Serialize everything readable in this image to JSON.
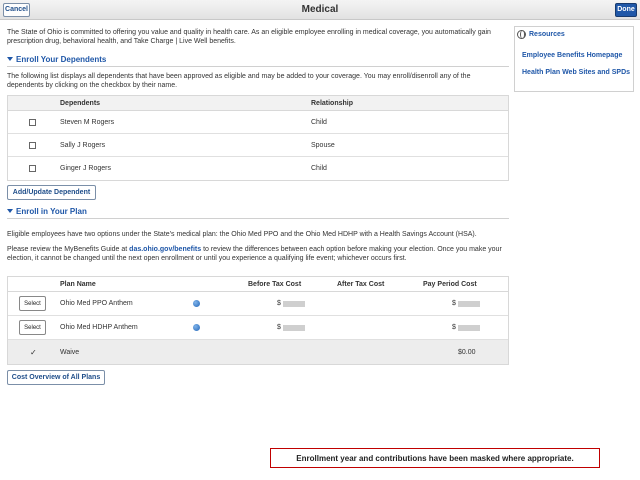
{
  "header": {
    "title": "Medical",
    "cancel_label": "Cancel",
    "done_label": "Done"
  },
  "intro_text": "The State of Ohio is committed to offering you value and quality in health care. As an eligible employee enrolling in medical coverage, you automatically gain prescription drug, behavioral health, and Take Charge | Live Well benefits.",
  "dependents": {
    "heading": "Enroll Your Dependents",
    "description": "The following list displays all dependents that have been approved as eligible and may be added to your coverage. You may enroll/disenroll any of the dependents by clicking on the checkbox by their name.",
    "col_dependents": "Dependents",
    "col_relationship": "Relationship",
    "rows": [
      {
        "name": "Steven M Rogers",
        "relationship": "Child"
      },
      {
        "name": "Sally J Rogers",
        "relationship": "Spouse"
      },
      {
        "name": "Ginger J Rogers",
        "relationship": "Child"
      }
    ],
    "add_button": "Add/Update Dependent"
  },
  "plan": {
    "heading": "Enroll in Your Plan",
    "para1": "Eligible employees have two options under the State's medical plan: the Ohio Med PPO and the Ohio Med HDHP with a Health Savings Account (HSA).",
    "para2_before": "Please review the MyBenefits Guide at ",
    "para2_link": "das.ohio.gov/benefits",
    "para2_after": " to review the differences between each option before making your election. Once you make your election, it cannot be changed until the next open enrollment or until you experience a qualifying life event; whichever occurs first.",
    "col_plan_name": "Plan Name",
    "col_before_tax": "Before Tax Cost",
    "col_after_tax": "After Tax Cost",
    "col_pay_period": "Pay Period Cost",
    "select_label": "Select",
    "currency": "$",
    "rows": [
      {
        "name": "Ohio Med PPO Anthem"
      },
      {
        "name": "Ohio Med HDHP Anthem"
      }
    ],
    "waive_check": "✓",
    "waive_label": "Waive",
    "waive_cost": "$0.00",
    "overview_button": "Cost Overview of All Plans"
  },
  "resources": {
    "heading": "Resources",
    "links": [
      "Employee Benefits Homepage",
      "Health Plan Web Sites and SPDs"
    ]
  },
  "notice": "Enrollment year and contributions have been masked where appropriate.",
  "colors": {
    "accent": "#1f57a8",
    "notice_border": "#c00000"
  },
  "icons": {
    "resources": "globe-icon",
    "plan_info": "info-icon",
    "section_toggle": "caret-down-icon"
  }
}
